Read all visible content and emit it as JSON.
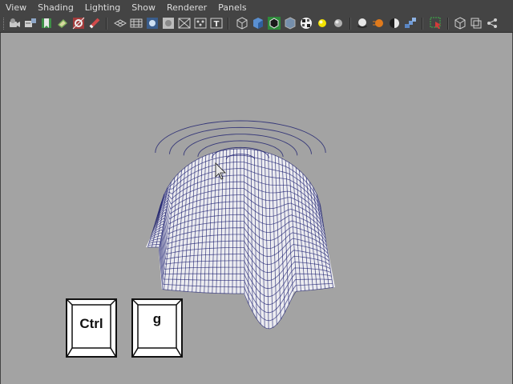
{
  "menu": [
    "View",
    "Shading",
    "Lighting",
    "Show",
    "Renderer",
    "Panels"
  ],
  "toolbar_icons": [
    "select-camera-icon",
    "camera-attributes-icon",
    "bookmark-icon",
    "image-plane-icon",
    "2d-pan-zoom-icon",
    "grease-pencil-icon",
    "grid-icon",
    "film-gate-icon",
    "resolution-gate-icon",
    "gate-mask-icon",
    "field-chart-icon",
    "safe-action-icon",
    "safe-title-icon",
    "wireframe-icon",
    "smooth-shade-icon",
    "wireframe-on-shaded-icon",
    "xray-icon",
    "textured-icon",
    "use-all-lights-icon",
    "shadows-icon",
    "screen-space-ambient-occlusion-icon",
    "motion-blur-icon",
    "multisample-antialiasing-icon",
    "depth-of-field-icon",
    "isolate-select-icon",
    "xray-joints-icon",
    "xray-active-components-icon",
    "hypershade-icon"
  ],
  "keys": [
    {
      "label": "Ctrl"
    },
    {
      "label": "g"
    }
  ],
  "colors": {
    "ui_background": "#444444",
    "menu_text": "#dcdcdc",
    "viewport_background": "#a3a3a3",
    "wireframe": "#1a1d6e"
  }
}
